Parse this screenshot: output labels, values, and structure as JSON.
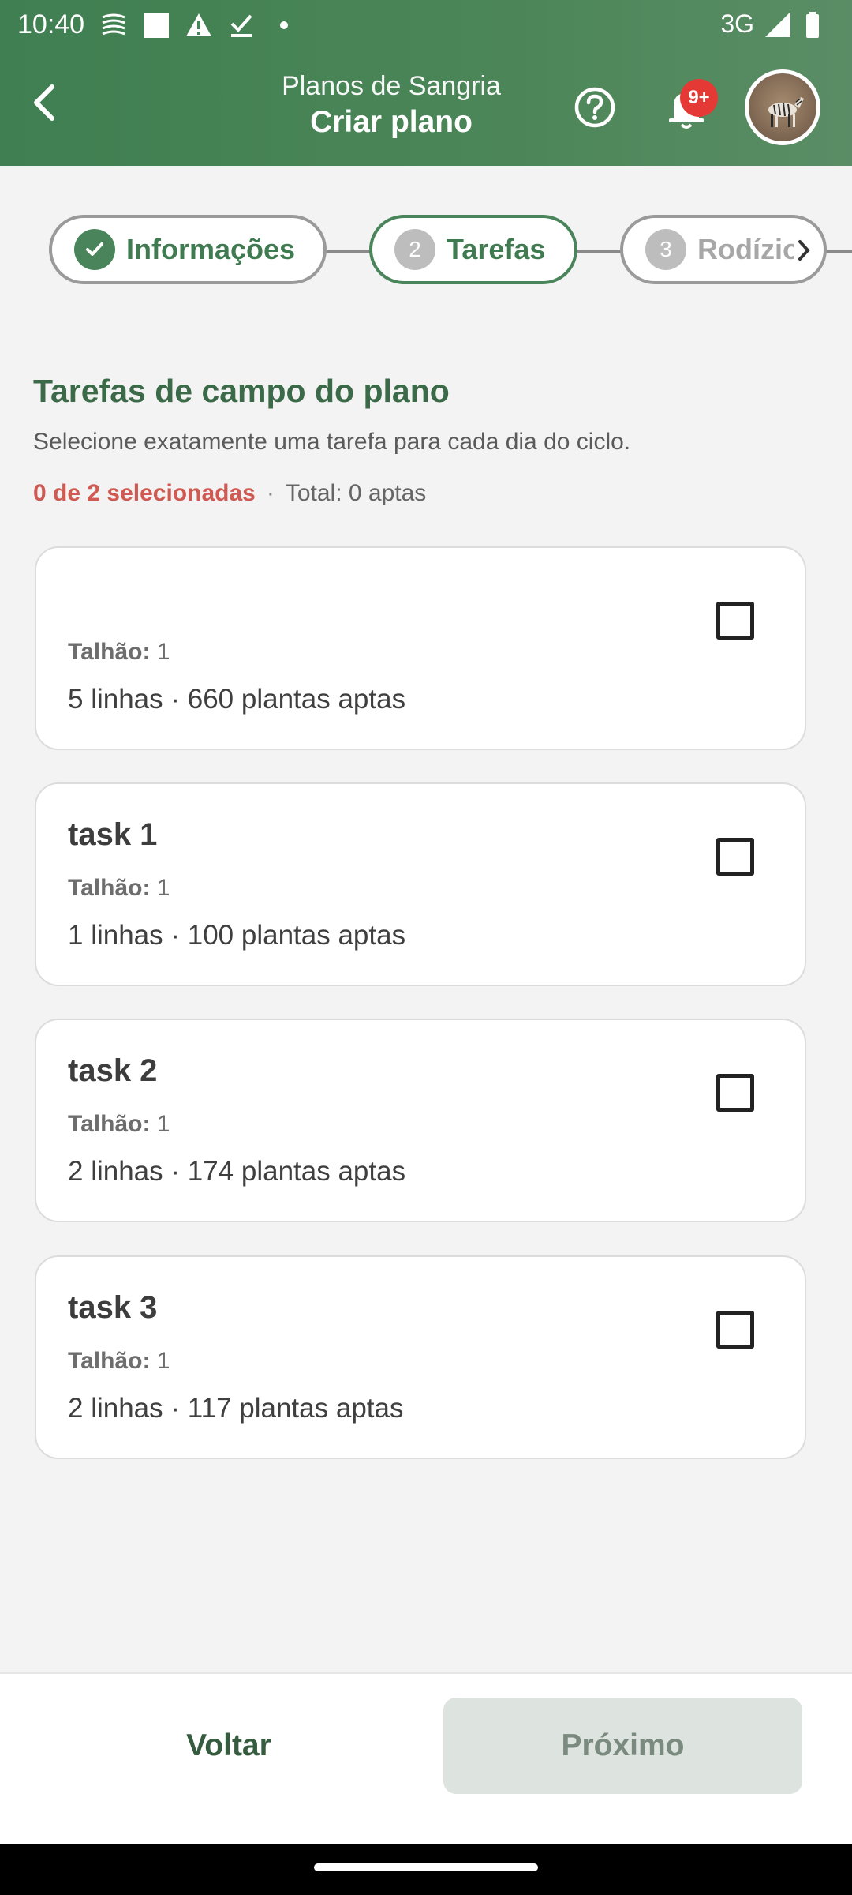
{
  "status_bar": {
    "time": "10:40",
    "network": "3G",
    "icons": [
      "notification-lines-icon",
      "square-notification-icon",
      "warning-icon",
      "download-done-icon",
      "dot-icon",
      "signal-icon",
      "battery-icon"
    ]
  },
  "header": {
    "supertitle": "Planos de Sangria",
    "title": "Criar plano",
    "notification_badge": "9+"
  },
  "stepper": {
    "steps": [
      {
        "number": "1",
        "label": "Informações",
        "state": "completed"
      },
      {
        "number": "2",
        "label": "Tarefas",
        "state": "active"
      },
      {
        "number": "3",
        "label": "Rodízio",
        "state": "inactive"
      }
    ]
  },
  "section": {
    "title": "Tarefas de campo do plano",
    "subtitle": "Selecione exatamente uma tarefa para cada dia do ciclo.",
    "selected_text": "0 de 2 selecionadas",
    "separator": "·",
    "total_text": "Total: 0 aptas"
  },
  "tasks": [
    {
      "name": "",
      "talhao_label": "Talhão:",
      "talhao_value": "1",
      "stats": "5 linhas · 660 plantas aptas",
      "checked": false
    },
    {
      "name": "task 1",
      "talhao_label": "Talhão:",
      "talhao_value": "1",
      "stats": "1 linhas · 100 plantas aptas",
      "checked": false
    },
    {
      "name": "task 2",
      "talhao_label": "Talhão:",
      "talhao_value": "1",
      "stats": "2 linhas · 174 plantas aptas",
      "checked": false
    },
    {
      "name": "task 3",
      "talhao_label": "Talhão:",
      "talhao_value": "1",
      "stats": "2 linhas · 117 plantas aptas",
      "checked": false
    }
  ],
  "footer": {
    "back_label": "Voltar",
    "next_label": "Próximo",
    "next_enabled": false
  },
  "colors": {
    "primary": "#3f7f51",
    "danger": "#d05a52",
    "badge": "#e53935",
    "disabled_button": "#dde3df"
  }
}
